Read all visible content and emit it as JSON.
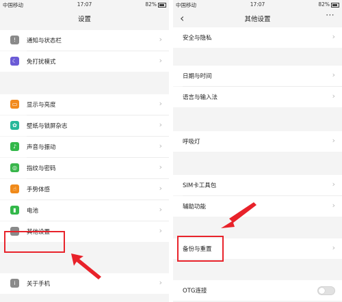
{
  "left": {
    "status": {
      "carrier": "中国移动",
      "time": "17:07",
      "battery": "82%"
    },
    "title": "设置",
    "items": [
      {
        "label": "通知与状态栏",
        "icon": "notification-icon",
        "color": "#8a8a8a"
      },
      {
        "label": "免打扰模式",
        "icon": "moon-icon",
        "color": "#6b5bd6"
      },
      {
        "label": "显示与亮度",
        "icon": "display-icon",
        "color": "#f28a1e"
      },
      {
        "label": "壁纸与锁屏杂志",
        "icon": "wallpaper-icon",
        "color": "#27b89a"
      },
      {
        "label": "声音与振动",
        "icon": "sound-icon",
        "color": "#33b84a"
      },
      {
        "label": "指纹与密码",
        "icon": "fingerprint-icon",
        "color": "#39b64b"
      },
      {
        "label": "手势体感",
        "icon": "gesture-icon",
        "color": "#f08a1a"
      },
      {
        "label": "电池",
        "icon": "battery-icon",
        "color": "#33b84a"
      },
      {
        "label": "其他设置",
        "icon": "more-icon",
        "color": "#8a8a8a"
      },
      {
        "label": "关于手机",
        "icon": "info-icon",
        "color": "#8a8a8a"
      }
    ]
  },
  "right": {
    "status": {
      "carrier": "中国移动",
      "time": "17:07",
      "battery": "82%"
    },
    "title": "其他设置",
    "items": [
      {
        "label": "安全与隐私"
      },
      {
        "label": "日期与时间"
      },
      {
        "label": "语言与输入法"
      },
      {
        "label": "呼吸灯"
      },
      {
        "label": "SIM卡工具包"
      },
      {
        "label": "辅助功能"
      },
      {
        "label": "备份与重置"
      },
      {
        "label": "OTG连接",
        "toggle_on": false
      }
    ]
  },
  "highlight_color": "#e8222a"
}
